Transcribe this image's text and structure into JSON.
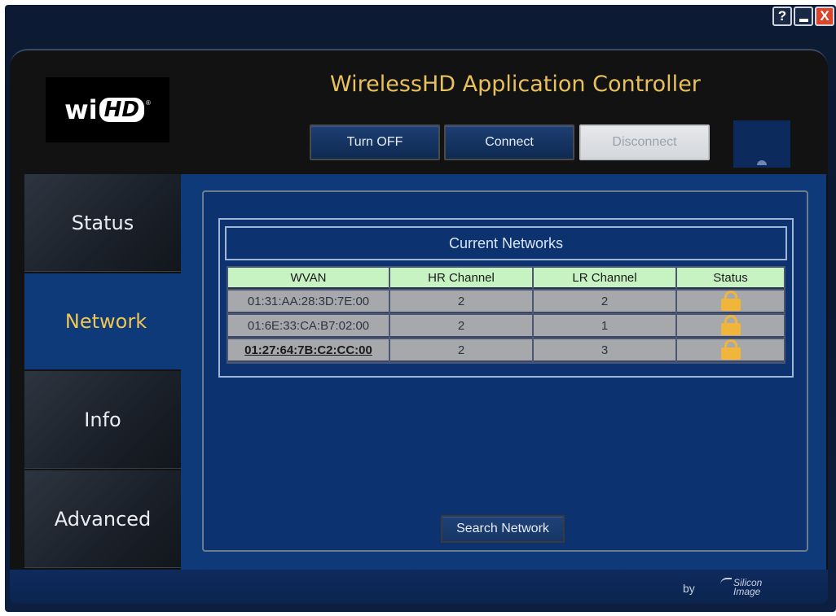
{
  "window_controls": {
    "help": "?",
    "minimize": "",
    "close": "X"
  },
  "logo": {
    "wi": "wi",
    "hd": "HD",
    "reg": "®"
  },
  "app_title": "WirelessHD Application Controller",
  "toolbar": {
    "turn_off": "Turn OFF",
    "connect": "Connect",
    "disconnect": "Disconnect"
  },
  "tabs": [
    {
      "label": "Status",
      "active": false
    },
    {
      "label": "Network",
      "active": true
    },
    {
      "label": "Info",
      "active": false
    },
    {
      "label": "Advanced",
      "active": false
    }
  ],
  "networks": {
    "title": "Current Networks",
    "columns": [
      "WVAN",
      "HR Channel",
      "LR Channel",
      "Status"
    ],
    "rows": [
      {
        "wvan": "01:31:AA:28:3D:7E:00",
        "hr_channel": "2",
        "lr_channel": "2",
        "status_icon": "lock-icon",
        "selected": false
      },
      {
        "wvan": "01:6E:33:CA:B7:02:00",
        "hr_channel": "2",
        "lr_channel": "1",
        "status_icon": "lock-icon",
        "selected": false
      },
      {
        "wvan": "01:27:64:7B:C2:CC:00",
        "hr_channel": "2",
        "lr_channel": "3",
        "status_icon": "lock-icon",
        "selected": true
      }
    ]
  },
  "search_button": "Search Network",
  "footer": {
    "by": "by",
    "brand_line1": "Silicon",
    "brand_line2": "Image"
  },
  "colors": {
    "title_gold": "#e8c15a",
    "active_tab_bg": "#0f3a7a",
    "active_tab_text": "#f0c850",
    "header_row_bg": "#c7f3c3",
    "lock": "#f0b53a"
  }
}
